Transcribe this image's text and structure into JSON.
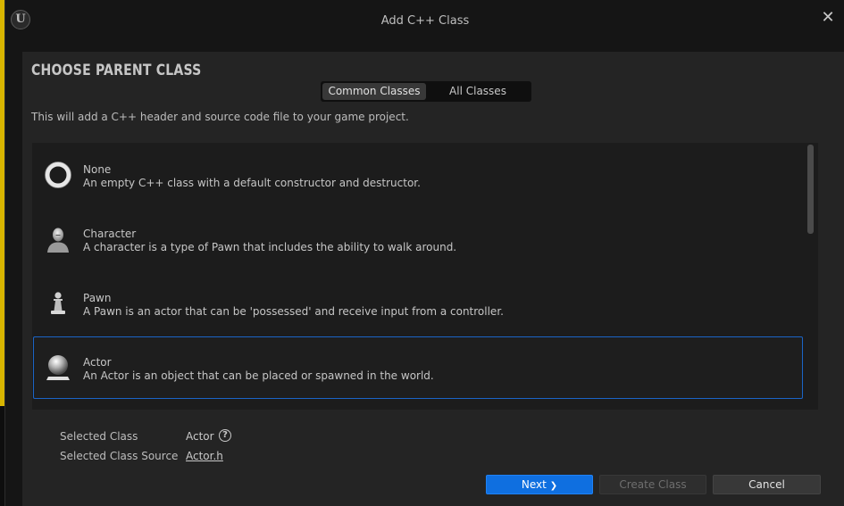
{
  "window": {
    "title": "Add C++ Class",
    "logo_text": "U",
    "close_glyph": "✕"
  },
  "dialog": {
    "heading": "CHOOSE PARENT CLASS",
    "tabs": [
      {
        "label": "Common Classes",
        "active": true
      },
      {
        "label": "All Classes",
        "active": false
      }
    ],
    "subtitle": "This will add a C++ header and source code file to your game project.",
    "classes": [
      {
        "name": "None",
        "description": "An empty C++ class with a default constructor and destructor.",
        "icon": "ring-icon"
      },
      {
        "name": "Character",
        "description": "A character is a type of Pawn that includes the ability to walk around.",
        "icon": "character-icon"
      },
      {
        "name": "Pawn",
        "description": "A Pawn is an actor that can be 'possessed' and receive input from a controller.",
        "icon": "pawn-icon"
      },
      {
        "name": "Actor",
        "description": "An Actor is an object that can be placed or spawned in the world.",
        "icon": "actor-sphere-icon",
        "selected": true
      }
    ],
    "selected_class_label": "Selected Class",
    "selected_class_value": "Actor",
    "help_glyph": "?",
    "selected_source_label": "Selected Class Source",
    "selected_source_value": "Actor.h",
    "buttons": {
      "next": "Next",
      "next_glyph": "❯",
      "create": "Create Class",
      "cancel": "Cancel"
    }
  },
  "colors": {
    "accent": "#0f6fe0",
    "selection_border": "#1b64c6",
    "panel_bg": "#242424",
    "list_bg": "#1c1c1c"
  }
}
